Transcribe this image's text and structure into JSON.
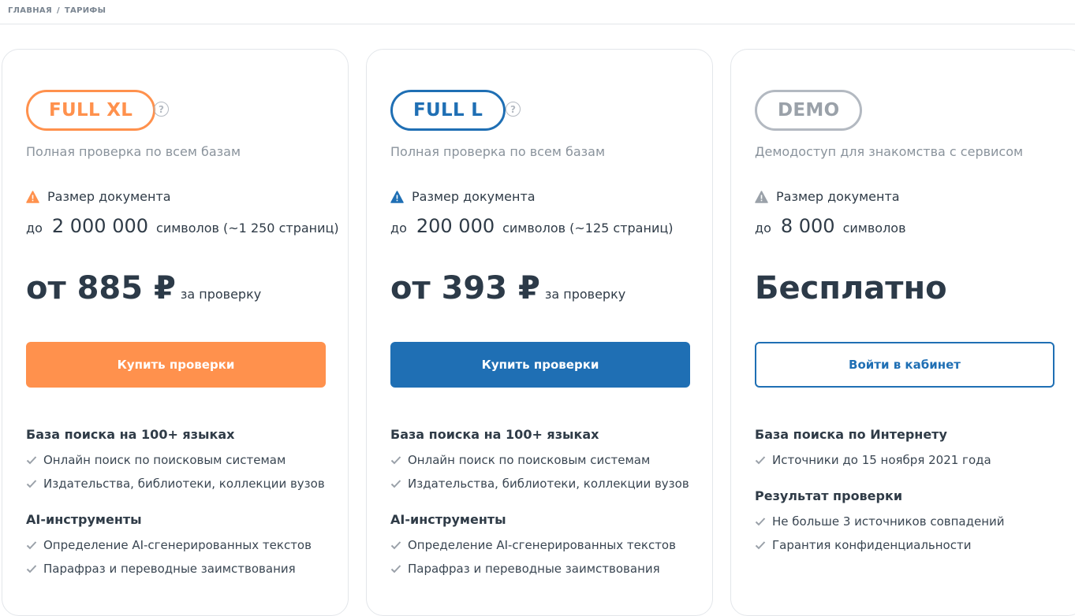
{
  "breadcrumb": {
    "home": "ГЛАВНАЯ",
    "separator": "/",
    "current": "ТАРИФЫ"
  },
  "colors": {
    "orange": "#ff914d",
    "blue": "#1f6fb4",
    "gray": "#9aa1a9"
  },
  "plans": [
    {
      "name": "FULL XL",
      "help": "?",
      "subtitle": "Полная проверка по всем базам",
      "size_label": "Размер документа",
      "limit_prefix": "до",
      "limit_value": "2 000 000",
      "limit_suffix": "символов (~1 250 страниц)",
      "price": "от 885 ₽",
      "price_suffix": "за проверку",
      "button": "Купить проверки",
      "groups": [
        {
          "title": "База поиска на 100+ языках",
          "items": [
            "Онлайн поиск по поисковым системам",
            "Издательства, библиотеки, коллекции вузов"
          ]
        },
        {
          "title": "AI-инструменты",
          "items": [
            "Определение AI-сгенерированных текстов",
            "Парафраз и переводные заимствования"
          ]
        }
      ]
    },
    {
      "name": "FULL L",
      "help": "?",
      "subtitle": "Полная проверка по всем базам",
      "size_label": "Размер документа",
      "limit_prefix": "до",
      "limit_value": "200 000",
      "limit_suffix": "символов (~125 страниц)",
      "price": "от 393 ₽",
      "price_suffix": "за проверку",
      "button": "Купить проверки",
      "groups": [
        {
          "title": "База поиска на 100+ языках",
          "items": [
            "Онлайн поиск по поисковым системам",
            "Издательства, библиотеки, коллекции вузов"
          ]
        },
        {
          "title": "AI-инструменты",
          "items": [
            "Определение AI-сгенерированных текстов",
            "Парафраз и переводные заимствования"
          ]
        }
      ]
    },
    {
      "name": "DEMO",
      "subtitle": "Демодоступ для знакомства с сервисом",
      "size_label": "Размер документа",
      "limit_prefix": "до",
      "limit_value": "8 000",
      "limit_suffix": "символов",
      "price": "Бесплатно",
      "button": "Войти в кабинет",
      "groups": [
        {
          "title": "База поиска по Интернету",
          "items": [
            "Источники до 15 ноября 2021 года"
          ]
        },
        {
          "title": "Результат проверки",
          "items": [
            "Не больше 3 источников совпадений",
            "Гарантия конфиденциальности"
          ]
        }
      ]
    }
  ]
}
